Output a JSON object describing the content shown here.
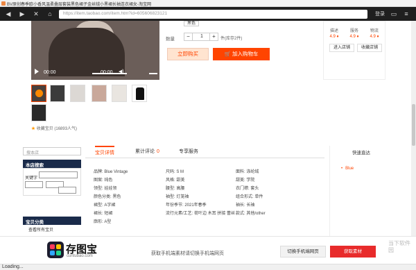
{
  "window": {
    "title": "BV原创春季欧小香风温柔叠层套装黑色裙子金丝绒小黑裙长袖连衣裙女-淘宝网"
  },
  "toolbar": {
    "back_icon": "back-arrow-icon",
    "forward_icon": "forward-arrow-icon",
    "close_icon": "close-icon",
    "home_icon": "home-icon",
    "url": "https://item.taobao.com/item.htm?id=605606823121",
    "login": "登录",
    "folder_icon": "folder-icon",
    "menu_icon": "menu-icon"
  },
  "video": {
    "current_time": "00:00",
    "duration": "00:00"
  },
  "purchase": {
    "color_chip": "黑色",
    "quantity_label": "数量",
    "quantity": "1",
    "stock": "件(库存2件)",
    "buy_now": "立即购买",
    "add_to_cart": "加入购物车"
  },
  "favorite": {
    "text": "收藏宝贝 (16893人气)"
  },
  "shop": {
    "ratings": [
      {
        "label": "描述",
        "value": "4.9 ♦"
      },
      {
        "label": "服务",
        "value": "4.9 ♦"
      },
      {
        "label": "物流",
        "value": "4.9 ♦"
      }
    ],
    "enter_shop": "进入店铺",
    "fav_shop": "收藏店铺"
  },
  "sidebar": {
    "search_placeholder": "搜本店",
    "search_head": "本店搜索",
    "keyword_label": "关键字",
    "price_label": "价格",
    "category_head": "宝贝分类",
    "view_all": "查看所有宝贝"
  },
  "tabs": [
    {
      "label": "宝贝详情"
    },
    {
      "label": "累计评论",
      "badge": "0"
    },
    {
      "label": "专享服务"
    }
  ],
  "attributes": [
    "品牌: Blue Vintage",
    "尺码: S M",
    "面料: 涤纶绒",
    "图案: 纯色",
    "风格: 甜美",
    "甜美: 学院",
    "领型: 娃娃领",
    "腰型: 高腰",
    "衣门襟: 套头",
    "颜色分类: 黑色",
    "袖型: 灯笼袖",
    "组合形式: 单件",
    "裙型: A字裙",
    "年份季节: 2021年春季",
    "袖长: 长袖",
    "裙长: 短裙",
    "流行元素/工艺: 荷叶边 木耳 拼接 蕾丝",
    "款式: 其他/other",
    "廓形: A型"
  ],
  "right_panel": {
    "heading": "快速直达",
    "item": "Blue"
  },
  "banner": {
    "logo_title": "存图宝",
    "logo_sub": "cuntubao.com",
    "tip": "获取手机端素材请切换手机端网页",
    "switch_btn": "切换手机端网页",
    "get_btn": "获取素材",
    "watermark": "当下软件园"
  },
  "status": {
    "text": "Loading..."
  }
}
